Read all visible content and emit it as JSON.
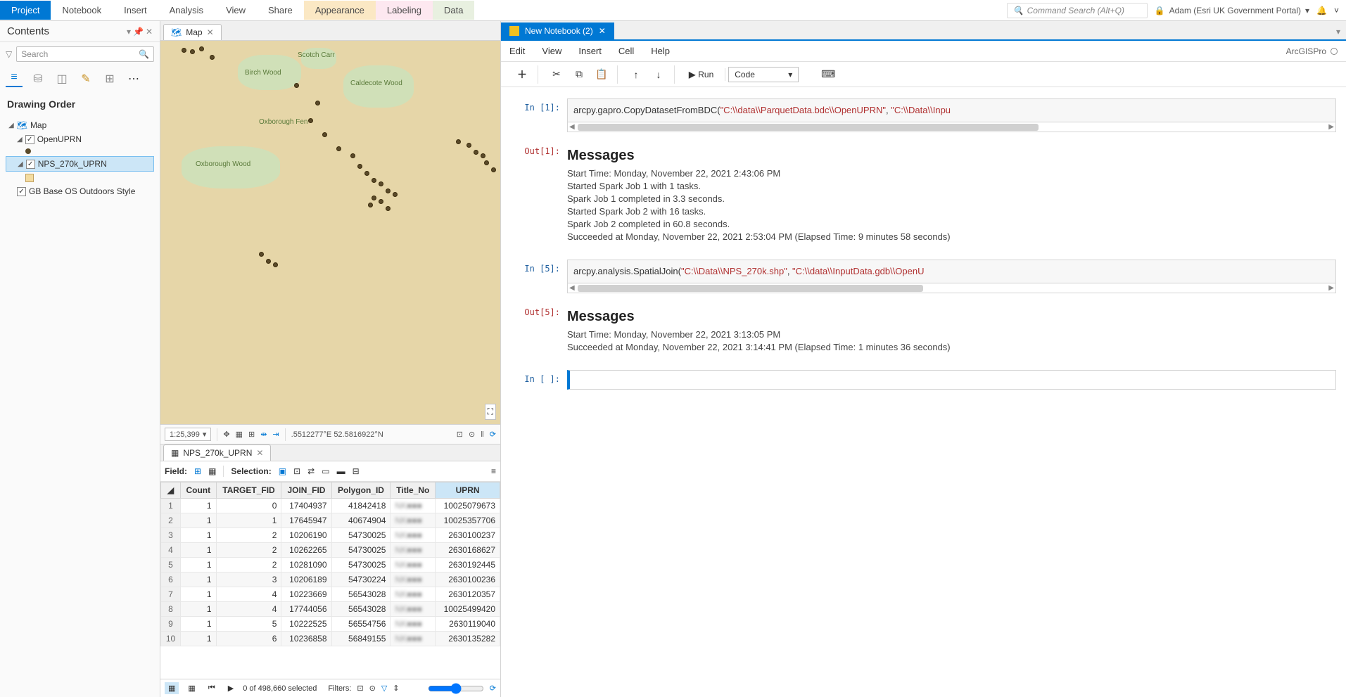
{
  "ribbon": {
    "tabs": [
      "Project",
      "Notebook",
      "Insert",
      "Analysis",
      "View",
      "Share",
      "Appearance",
      "Labeling",
      "Data"
    ],
    "search_placeholder": "Command Search (Alt+Q)",
    "user": "Adam (Esri UK Government Portal)"
  },
  "contents": {
    "title": "Contents",
    "search_placeholder": "Search",
    "drawing_order": "Drawing Order",
    "map_label": "Map",
    "layers": {
      "open_uprn": "OpenUPRN",
      "nps": "NPS_270k_UPRN",
      "basemap": "GB Base OS Outdoors Style"
    }
  },
  "map": {
    "tab_label": "Map",
    "woods": [
      "Birch Wood",
      "Scotch Carr",
      "Caldecote Wood",
      "Oxborough Wood",
      "Oxborough Fen"
    ],
    "scale": "1:25,399",
    "coords": ".5512277°E 52.5816922°N"
  },
  "table": {
    "tab_label": "NPS_270k_UPRN",
    "field_label": "Field:",
    "selection_label": "Selection:",
    "columns": [
      "Count",
      "TARGET_FID",
      "JOIN_FID",
      "Polygon_ID",
      "Title_No",
      "UPRN"
    ],
    "rows": [
      {
        "n": 1,
        "Count": 1,
        "TARGET_FID": 0,
        "JOIN_FID": 17404937,
        "Polygon_ID": 41842418,
        "Title_No": "NK■■■",
        "UPRN": 10025079673
      },
      {
        "n": 2,
        "Count": 1,
        "TARGET_FID": 1,
        "JOIN_FID": 17645947,
        "Polygon_ID": 40674904,
        "Title_No": "NK■■■",
        "UPRN": 10025357706
      },
      {
        "n": 3,
        "Count": 1,
        "TARGET_FID": 2,
        "JOIN_FID": 10206190,
        "Polygon_ID": 54730025,
        "Title_No": "NK■■■",
        "UPRN": 2630100237
      },
      {
        "n": 4,
        "Count": 1,
        "TARGET_FID": 2,
        "JOIN_FID": 10262265,
        "Polygon_ID": 54730025,
        "Title_No": "NK■■■",
        "UPRN": 2630168627
      },
      {
        "n": 5,
        "Count": 1,
        "TARGET_FID": 2,
        "JOIN_FID": 10281090,
        "Polygon_ID": 54730025,
        "Title_No": "NK■■■",
        "UPRN": 2630192445
      },
      {
        "n": 6,
        "Count": 1,
        "TARGET_FID": 3,
        "JOIN_FID": 10206189,
        "Polygon_ID": 54730224,
        "Title_No": "NK■■■",
        "UPRN": 2630100236
      },
      {
        "n": 7,
        "Count": 1,
        "TARGET_FID": 4,
        "JOIN_FID": 10223669,
        "Polygon_ID": 56543028,
        "Title_No": "NK■■■",
        "UPRN": 2630120357
      },
      {
        "n": 8,
        "Count": 1,
        "TARGET_FID": 4,
        "JOIN_FID": 17744056,
        "Polygon_ID": 56543028,
        "Title_No": "NK■■■",
        "UPRN": 10025499420
      },
      {
        "n": 9,
        "Count": 1,
        "TARGET_FID": 5,
        "JOIN_FID": 10222525,
        "Polygon_ID": 56554756,
        "Title_No": "NK■■■",
        "UPRN": 2630119040
      },
      {
        "n": 10,
        "Count": 1,
        "TARGET_FID": 6,
        "JOIN_FID": 10236858,
        "Polygon_ID": 56849155,
        "Title_No": "NK■■■",
        "UPRN": 2630135282
      }
    ],
    "footer": {
      "selected": "0 of 498,660 selected",
      "filters_label": "Filters:"
    }
  },
  "notebook": {
    "tab_label": "New Notebook (2)",
    "menus": [
      "Edit",
      "View",
      "Insert",
      "Cell",
      "Help"
    ],
    "kernel": "ArcGISPro",
    "run_label": "Run",
    "celltype": "Code",
    "cells": {
      "in1_prompt": "In [1]:",
      "in1_code_pre": "arcpy.gapro.CopyDatasetFromBDC(",
      "in1_arg1": "\"C:\\\\data\\\\ParquetData.bdc\\\\OpenUPRN\"",
      "in1_sep": ", ",
      "in1_arg2": "\"C:\\\\Data\\\\Inpu",
      "out1_prompt": "Out[1]:",
      "out1_heading": "Messages",
      "out1_lines": [
        "Start Time: Monday, November 22, 2021 2:43:06 PM",
        "Started Spark Job 1 with 1 tasks.",
        "Spark Job 1 completed in 3.3 seconds.",
        "Started Spark Job 2 with 16 tasks.",
        "Spark Job 2 completed in 60.8 seconds.",
        "Succeeded at Monday, November 22, 2021 2:53:04 PM (Elapsed Time: 9 minutes 58 seconds)"
      ],
      "in5_prompt": "In [5]:",
      "in5_code_pre": "arcpy.analysis.SpatialJoin(",
      "in5_arg1": "\"C:\\\\Data\\\\NPS_270k.shp\"",
      "in5_sep": ", ",
      "in5_arg2": "\"C:\\\\data\\\\InputData.gdb\\\\OpenU",
      "out5_prompt": "Out[5]:",
      "out5_heading": "Messages",
      "out5_lines": [
        "Start Time: Monday, November 22, 2021 3:13:05 PM",
        "Succeeded at Monday, November 22, 2021 3:14:41 PM (Elapsed Time: 1 minutes 36 seconds)"
      ],
      "in_empty_prompt": "In [ ]:"
    }
  }
}
